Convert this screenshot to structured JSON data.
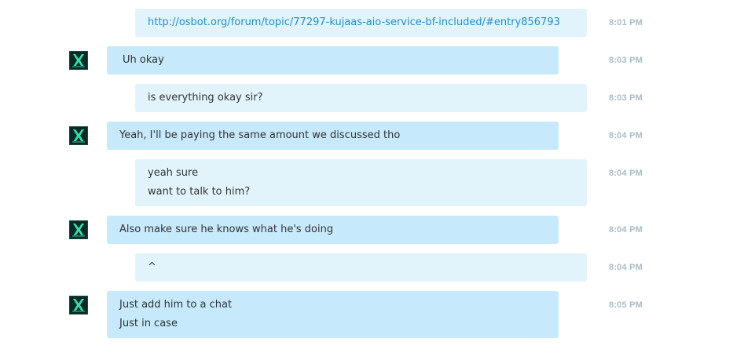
{
  "colors": {
    "incoming_bubble": "#c6e9fb",
    "outgoing_bubble": "#e1f4fc",
    "link": "#1d8fd1",
    "timestamp": "#a7bcc9",
    "avatar_accent": "#2fe3a8"
  },
  "messages": [
    {
      "direction": "outgoing",
      "lines": [
        "http://osbot.org/forum/topic/77297-kujaas-aio-service-bf-included/#entry856793"
      ],
      "time": "8:01 PM",
      "is_link": true
    },
    {
      "direction": "incoming",
      "avatar": "avatar-icon",
      "lines": [
        "Uh okay"
      ],
      "time": "8:03 PM"
    },
    {
      "direction": "outgoing",
      "lines": [
        "is everything okay sir?"
      ],
      "time": "8:03 PM"
    },
    {
      "direction": "incoming",
      "avatar": "avatar-icon",
      "lines": [
        "Yeah, I'll be paying the same amount we discussed tho"
      ],
      "time": "8:04 PM"
    },
    {
      "direction": "outgoing",
      "lines": [
        "yeah sure",
        "want to talk to him?"
      ],
      "time": "8:04 PM"
    },
    {
      "direction": "incoming",
      "avatar": "avatar-icon",
      "lines": [
        "Also make sure he knows what he's doing"
      ],
      "time": "8:04 PM"
    },
    {
      "direction": "outgoing",
      "lines": [
        "^"
      ],
      "time": "8:04 PM"
    },
    {
      "direction": "incoming",
      "avatar": "avatar-icon",
      "lines": [
        "Just add him to a chat",
        "Just in case"
      ],
      "time": "8:05 PM"
    }
  ]
}
